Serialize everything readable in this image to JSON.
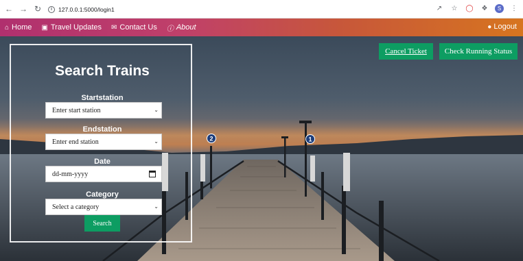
{
  "browser": {
    "url": "127.0.0.1:5000/login1",
    "profile_initial": "S"
  },
  "nav": {
    "home": "Home",
    "travel": "Travel Updates",
    "contact": "Contact Us",
    "about": "About",
    "logout": "Logout"
  },
  "actions": {
    "cancel": "Cancel Ticket",
    "status": "Check Running Status"
  },
  "form": {
    "title": "Search Trains",
    "start_label": "Startstation",
    "start_value": "Enter start station",
    "end_label": "Endstation",
    "end_value": "Enter end station",
    "date_label": "Date",
    "date_value": "dd-mm-yyyy",
    "category_label": "Category",
    "category_value": "Select a category",
    "submit": "Search"
  },
  "scene": {
    "pier_numbers": [
      "2",
      "1"
    ]
  },
  "colors": {
    "accent_green": "#0d9d62",
    "nav_gradient_start": "#b0306e",
    "nav_gradient_end": "#d7751f"
  }
}
